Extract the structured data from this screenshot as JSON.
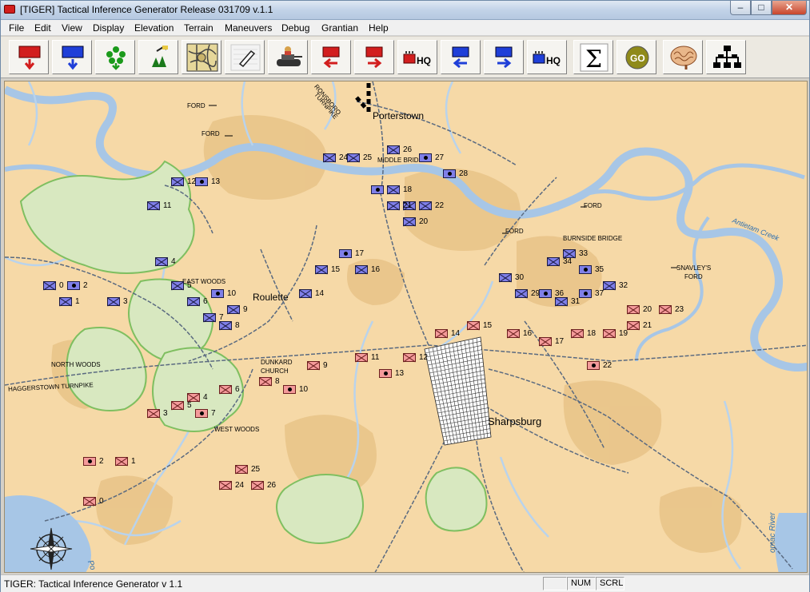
{
  "window": {
    "title": "[TIGER] Tactical Inference Generator Release 031709 v.1.1",
    "controls": {
      "minimize": "–",
      "maximize": "□",
      "close": "✕"
    }
  },
  "menu": [
    "File",
    "Edit",
    "View",
    "Display",
    "Elevation",
    "Terrain",
    "Maneuvers",
    "Debug",
    "Grantian",
    "Help"
  ],
  "toolbar": {
    "icons": [
      "red-unit-down-icon",
      "blue-unit-down-icon",
      "green-asterisk-icon",
      "forest-tool-icon",
      "terrain-map-icon",
      "pencil-eraser-icon",
      "tank-icon",
      "red-unit-left-icon",
      "red-unit-right-icon",
      "red-hq-icon",
      "blue-unit-left-icon",
      "blue-unit-right-icon",
      "blue-hq-icon",
      "sigma-icon",
      "go-icon",
      "brain-icon",
      "hierarchy-icon"
    ],
    "hq_label": "HQ",
    "sigma_label": "Σ",
    "go_label": "GO"
  },
  "colors": {
    "map_land": "#f6d9a7",
    "river": "#a7c6e6",
    "woods": "#8fbf78",
    "union_unit": "#7f7fe8",
    "confederate_unit": "#f49a9a",
    "accent_red": "#d21e1e",
    "accent_blue": "#1f3fd8"
  },
  "map": {
    "places": {
      "porterstown": "Porterstown",
      "roulette": "Roulette",
      "sharpsburg": "Sharpsburg",
      "dunkard_church": "DUNKARD",
      "dunkard_church_2": "CHURCH",
      "east_woods": "EAST WOODS",
      "north_woods": "NORTH WOODS",
      "west_woods": "WEST WOODS",
      "middle_bridge": "MIDDLE BRIDGE",
      "burnside_bridge": "BURNSIDE BRIDGE",
      "snavleys_ford": "SNAVLEY'S",
      "snavleys_ford_2": "FORD",
      "haggerstown": "HAGGERSTOWN TURNPIKE",
      "ronsboro": "RONSBORO",
      "turnpike": "TURNPIKE",
      "ford": "FORD"
    },
    "rivers": {
      "antietam": "Antietam Creek",
      "potomac": "omac River",
      "potomac_left": "Po"
    },
    "union_units": [
      {
        "n": "0",
        "hq": false
      },
      {
        "n": "1",
        "hq": false
      },
      {
        "n": "2",
        "hq": true
      },
      {
        "n": "3",
        "hq": false
      },
      {
        "n": "4",
        "hq": false
      },
      {
        "n": "5",
        "hq": false
      },
      {
        "n": "6",
        "hq": false
      },
      {
        "n": "7",
        "hq": false
      },
      {
        "n": "8",
        "hq": false
      },
      {
        "n": "9",
        "hq": false
      },
      {
        "n": "10",
        "hq": true
      },
      {
        "n": "11",
        "hq": false
      },
      {
        "n": "12",
        "hq": false
      },
      {
        "n": "13",
        "hq": true
      },
      {
        "n": "14",
        "hq": false
      },
      {
        "n": "15",
        "hq": false
      },
      {
        "n": "16",
        "hq": false
      },
      {
        "n": "17",
        "hq": true
      },
      {
        "n": "18",
        "hq": false
      },
      {
        "n": "19",
        "hq": false
      },
      {
        "n": "20",
        "hq": false
      },
      {
        "n": "21",
        "hq": false
      },
      {
        "n": "22",
        "hq": false
      },
      {
        "n": "24",
        "hq": false
      },
      {
        "n": "25",
        "hq": false
      },
      {
        "n": "26",
        "hq": false
      },
      {
        "n": "27",
        "hq": true
      },
      {
        "n": "28",
        "hq": true
      },
      {
        "n": "29",
        "hq": false
      },
      {
        "n": "30",
        "hq": false
      },
      {
        "n": "31",
        "hq": false
      },
      {
        "n": "32",
        "hq": false
      },
      {
        "n": "33",
        "hq": false
      },
      {
        "n": "34",
        "hq": false
      },
      {
        "n": "35",
        "hq": true
      },
      {
        "n": "36",
        "hq": true
      },
      {
        "n": "37",
        "hq": true
      },
      {
        "n": "",
        "hq": true
      }
    ],
    "confed_units": [
      {
        "n": "0",
        "hq": false
      },
      {
        "n": "1",
        "hq": false
      },
      {
        "n": "2",
        "hq": true
      },
      {
        "n": "3",
        "hq": false
      },
      {
        "n": "4",
        "hq": false
      },
      {
        "n": "5",
        "hq": false
      },
      {
        "n": "6",
        "hq": false
      },
      {
        "n": "7",
        "hq": true
      },
      {
        "n": "8",
        "hq": false
      },
      {
        "n": "9",
        "hq": false
      },
      {
        "n": "10",
        "hq": true
      },
      {
        "n": "11",
        "hq": false
      },
      {
        "n": "12",
        "hq": false
      },
      {
        "n": "13",
        "hq": true
      },
      {
        "n": "14",
        "hq": false
      },
      {
        "n": "15",
        "hq": false
      },
      {
        "n": "16",
        "hq": false
      },
      {
        "n": "17",
        "hq": false
      },
      {
        "n": "18",
        "hq": false
      },
      {
        "n": "19",
        "hq": false
      },
      {
        "n": "20",
        "hq": false
      },
      {
        "n": "21",
        "hq": false
      },
      {
        "n": "22",
        "hq": true
      },
      {
        "n": "23",
        "hq": false
      },
      {
        "n": "24",
        "hq": false
      },
      {
        "n": "25",
        "hq": false
      },
      {
        "n": "26",
        "hq": false
      }
    ]
  },
  "status": {
    "text": "TIGER: Tactical Inference Generator v 1.1",
    "num": "NUM",
    "scrl": "SCRL"
  }
}
